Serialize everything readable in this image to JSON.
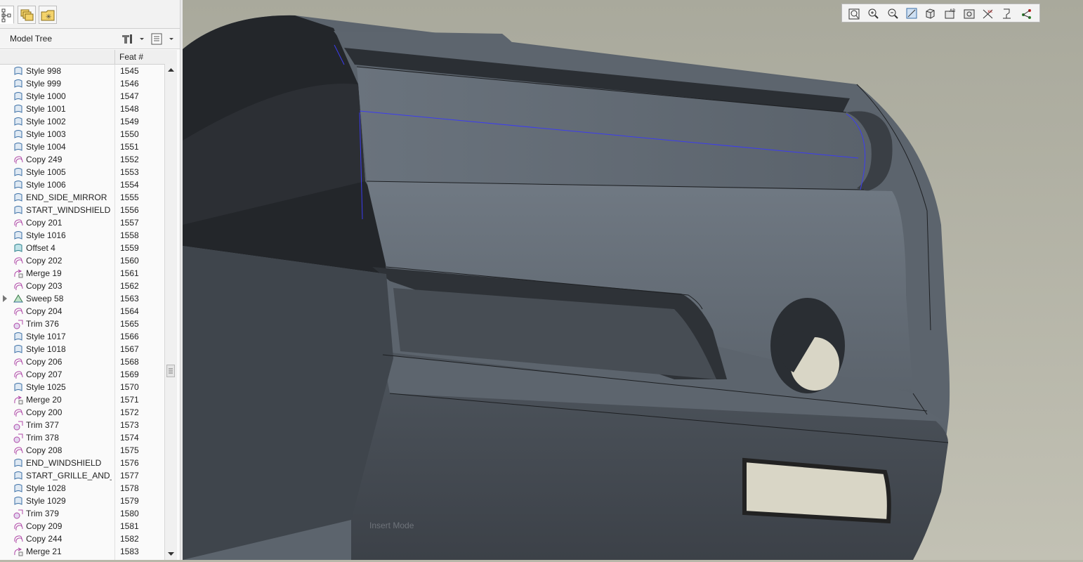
{
  "panel_tabs": [
    {
      "name": "model-tree-tab-icon"
    },
    {
      "name": "layers-tab-icon"
    },
    {
      "name": "favorites-tab-icon"
    }
  ],
  "model_tree": {
    "title": "Model Tree",
    "column_feat": "Feat #",
    "rows": [
      {
        "label": "Style 998",
        "num": "1545",
        "icon": "style"
      },
      {
        "label": "Style 999",
        "num": "1546",
        "icon": "style"
      },
      {
        "label": "Style 1000",
        "num": "1547",
        "icon": "style"
      },
      {
        "label": "Style 1001",
        "num": "1548",
        "icon": "style"
      },
      {
        "label": "Style 1002",
        "num": "1549",
        "icon": "style"
      },
      {
        "label": "Style 1003",
        "num": "1550",
        "icon": "style"
      },
      {
        "label": "Style 1004",
        "num": "1551",
        "icon": "style"
      },
      {
        "label": "Copy 249",
        "num": "1552",
        "icon": "copy"
      },
      {
        "label": "Style 1005",
        "num": "1553",
        "icon": "style"
      },
      {
        "label": "Style 1006",
        "num": "1554",
        "icon": "style"
      },
      {
        "label": "END_SIDE_MIRROR",
        "num": "1555",
        "icon": "style"
      },
      {
        "label": "START_WINDSHIELD",
        "num": "1556",
        "icon": "style"
      },
      {
        "label": "Copy 201",
        "num": "1557",
        "icon": "copy"
      },
      {
        "label": "Style 1016",
        "num": "1558",
        "icon": "style"
      },
      {
        "label": "Offset 4",
        "num": "1559",
        "icon": "offset"
      },
      {
        "label": "Copy 202",
        "num": "1560",
        "icon": "copy"
      },
      {
        "label": "Merge 19",
        "num": "1561",
        "icon": "merge"
      },
      {
        "label": "Copy 203",
        "num": "1562",
        "icon": "copy"
      },
      {
        "label": "Sweep 58",
        "num": "1563",
        "icon": "sweep",
        "expandable": true
      },
      {
        "label": "Copy 204",
        "num": "1564",
        "icon": "copy"
      },
      {
        "label": "Trim 376",
        "num": "1565",
        "icon": "trim"
      },
      {
        "label": "Style 1017",
        "num": "1566",
        "icon": "style"
      },
      {
        "label": "Style 1018",
        "num": "1567",
        "icon": "style"
      },
      {
        "label": "Copy 206",
        "num": "1568",
        "icon": "copy"
      },
      {
        "label": "Copy 207",
        "num": "1569",
        "icon": "copy"
      },
      {
        "label": "Style 1025",
        "num": "1570",
        "icon": "style"
      },
      {
        "label": "Merge 20",
        "num": "1571",
        "icon": "merge"
      },
      {
        "label": "Copy 200",
        "num": "1572",
        "icon": "copy"
      },
      {
        "label": "Trim 377",
        "num": "1573",
        "icon": "trim"
      },
      {
        "label": "Trim 378",
        "num": "1574",
        "icon": "trim"
      },
      {
        "label": "Copy 208",
        "num": "1575",
        "icon": "copy"
      },
      {
        "label": "END_WINDSHIELD",
        "num": "1576",
        "icon": "style"
      },
      {
        "label": "START_GRILLE_AND_",
        "num": "1577",
        "icon": "style"
      },
      {
        "label": "Style 1028",
        "num": "1578",
        "icon": "style"
      },
      {
        "label": "Style 1029",
        "num": "1579",
        "icon": "style"
      },
      {
        "label": "Trim 379",
        "num": "1580",
        "icon": "trim"
      },
      {
        "label": "Copy 209",
        "num": "1581",
        "icon": "copy"
      },
      {
        "label": "Copy 244",
        "num": "1582",
        "icon": "copy"
      },
      {
        "label": "Merge 21",
        "num": "1583",
        "icon": "merge"
      }
    ]
  },
  "view_toolbar": [
    {
      "name": "refit-icon"
    },
    {
      "name": "zoom-in-icon"
    },
    {
      "name": "zoom-out-icon"
    },
    {
      "name": "repaint-icon"
    },
    {
      "name": "display-style-icon"
    },
    {
      "name": "saved-views-icon"
    },
    {
      "name": "view-manager-icon"
    },
    {
      "name": "datum-display-icon"
    },
    {
      "name": "annotation-display-icon"
    },
    {
      "name": "spin-center-icon"
    }
  ],
  "viewport": {
    "mode_text": "Insert Mode"
  },
  "colors": {
    "viewport_bg": "#b8b7a9",
    "surface": "#5e6670",
    "dark_surface": "#25272b",
    "highlight_edge": "#3c3cf0"
  }
}
